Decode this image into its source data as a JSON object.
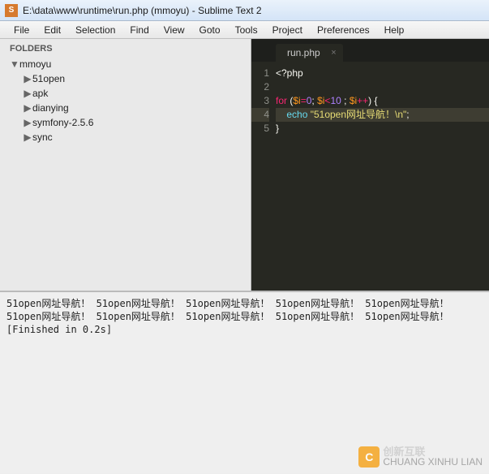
{
  "window": {
    "title": "E:\\data\\www\\runtime\\run.php (mmoyu) - Sublime Text 2"
  },
  "menu": {
    "items": [
      "File",
      "Edit",
      "Selection",
      "Find",
      "View",
      "Goto",
      "Tools",
      "Project",
      "Preferences",
      "Help"
    ]
  },
  "sidebar": {
    "header": "FOLDERS",
    "root": "mmoyu",
    "children": [
      "51open",
      "apk",
      "dianying",
      "symfony-2.5.6",
      "sync"
    ]
  },
  "tab": {
    "name": "run.php"
  },
  "code": {
    "line1": "<?php",
    "line3_for": "for",
    "line3_var": "$i",
    "line3_eq": "=",
    "line3_zero": "0",
    "line3_semi1": "; ",
    "line3_var2": "$i",
    "line3_lt": "<",
    "line3_ten": "10",
    "line3_semi2": " ; ",
    "line3_var3": "$i",
    "line3_inc": "++",
    "line3_end": ") {",
    "line4_echo": "echo",
    "line4_str": "\"51open网址导航！\\n\"",
    "line4_semi": ";",
    "line5": "}"
  },
  "console": {
    "repeat_line": "51open网址导航！",
    "repeat_count": 10,
    "finished": "[Finished in 0.2s]"
  },
  "watermark": {
    "brand_cn": "创新互联",
    "brand_py": "CHUANG XINHU LIAN"
  }
}
